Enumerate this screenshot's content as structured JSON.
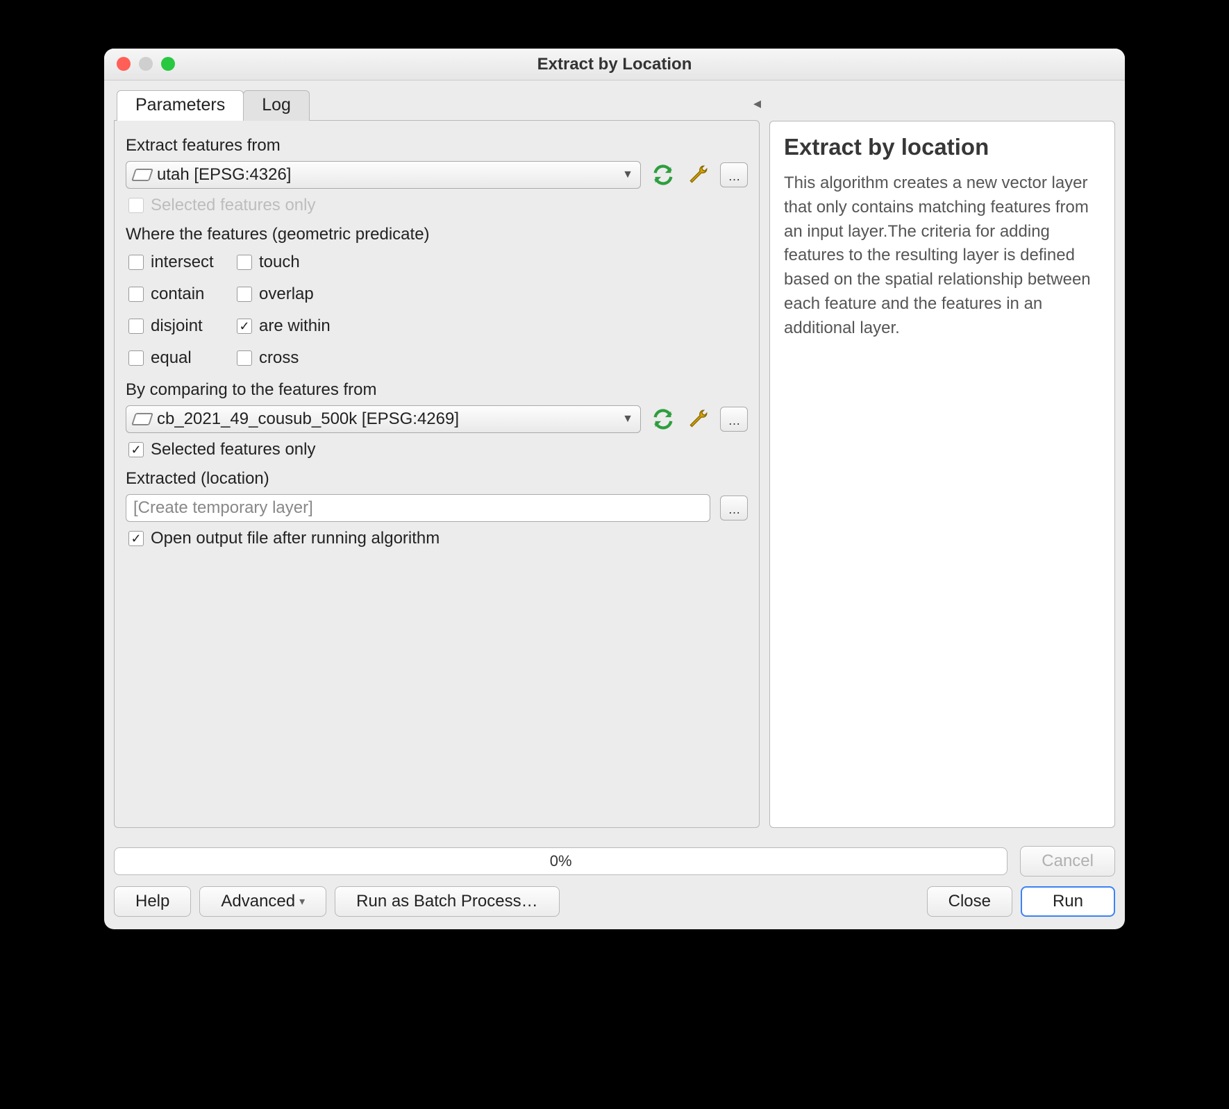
{
  "window": {
    "title": "Extract by Location"
  },
  "traffic": {
    "close": "#ff5f57",
    "minimize": "#cfcfcf",
    "zoom": "#28c840"
  },
  "tabs": {
    "parameters": "Parameters",
    "log": "Log"
  },
  "labels": {
    "extract_from": "Extract features from",
    "selected_only_src": "Selected features only",
    "predicate_header": "Where the features (geometric predicate)",
    "compare_to": "By comparing to the features from",
    "selected_only_cmp": "Selected features only",
    "output_header": "Extracted (location)",
    "open_after": "Open output file after running algorithm"
  },
  "extract_from": {
    "value": "utah [EPSG:4326]"
  },
  "compare_to": {
    "value": "cb_2021_49_cousub_500k [EPSG:4269]"
  },
  "predicates": {
    "intersect": {
      "label": "intersect",
      "checked": false
    },
    "touch": {
      "label": "touch",
      "checked": false
    },
    "contain": {
      "label": "contain",
      "checked": false
    },
    "overlap": {
      "label": "overlap",
      "checked": false
    },
    "disjoint": {
      "label": "disjoint",
      "checked": false
    },
    "are_within": {
      "label": "are within",
      "checked": true
    },
    "equal": {
      "label": "equal",
      "checked": false
    },
    "cross": {
      "label": "cross",
      "checked": false
    }
  },
  "selected_only_cmp_checked": true,
  "output": {
    "placeholder": "[Create temporary layer]"
  },
  "open_after_checked": true,
  "help": {
    "title": "Extract by location",
    "body": "This algorithm creates a new vector layer that only contains matching features from an input layer.The criteria for adding features to the resulting layer is defined based on the spatial relationship between each feature and the features in an additional layer."
  },
  "progress": {
    "text": "0%"
  },
  "buttons": {
    "cancel": "Cancel",
    "help": "Help",
    "advanced": "Advanced",
    "batch": "Run as Batch Process…",
    "close": "Close",
    "run": "Run"
  }
}
